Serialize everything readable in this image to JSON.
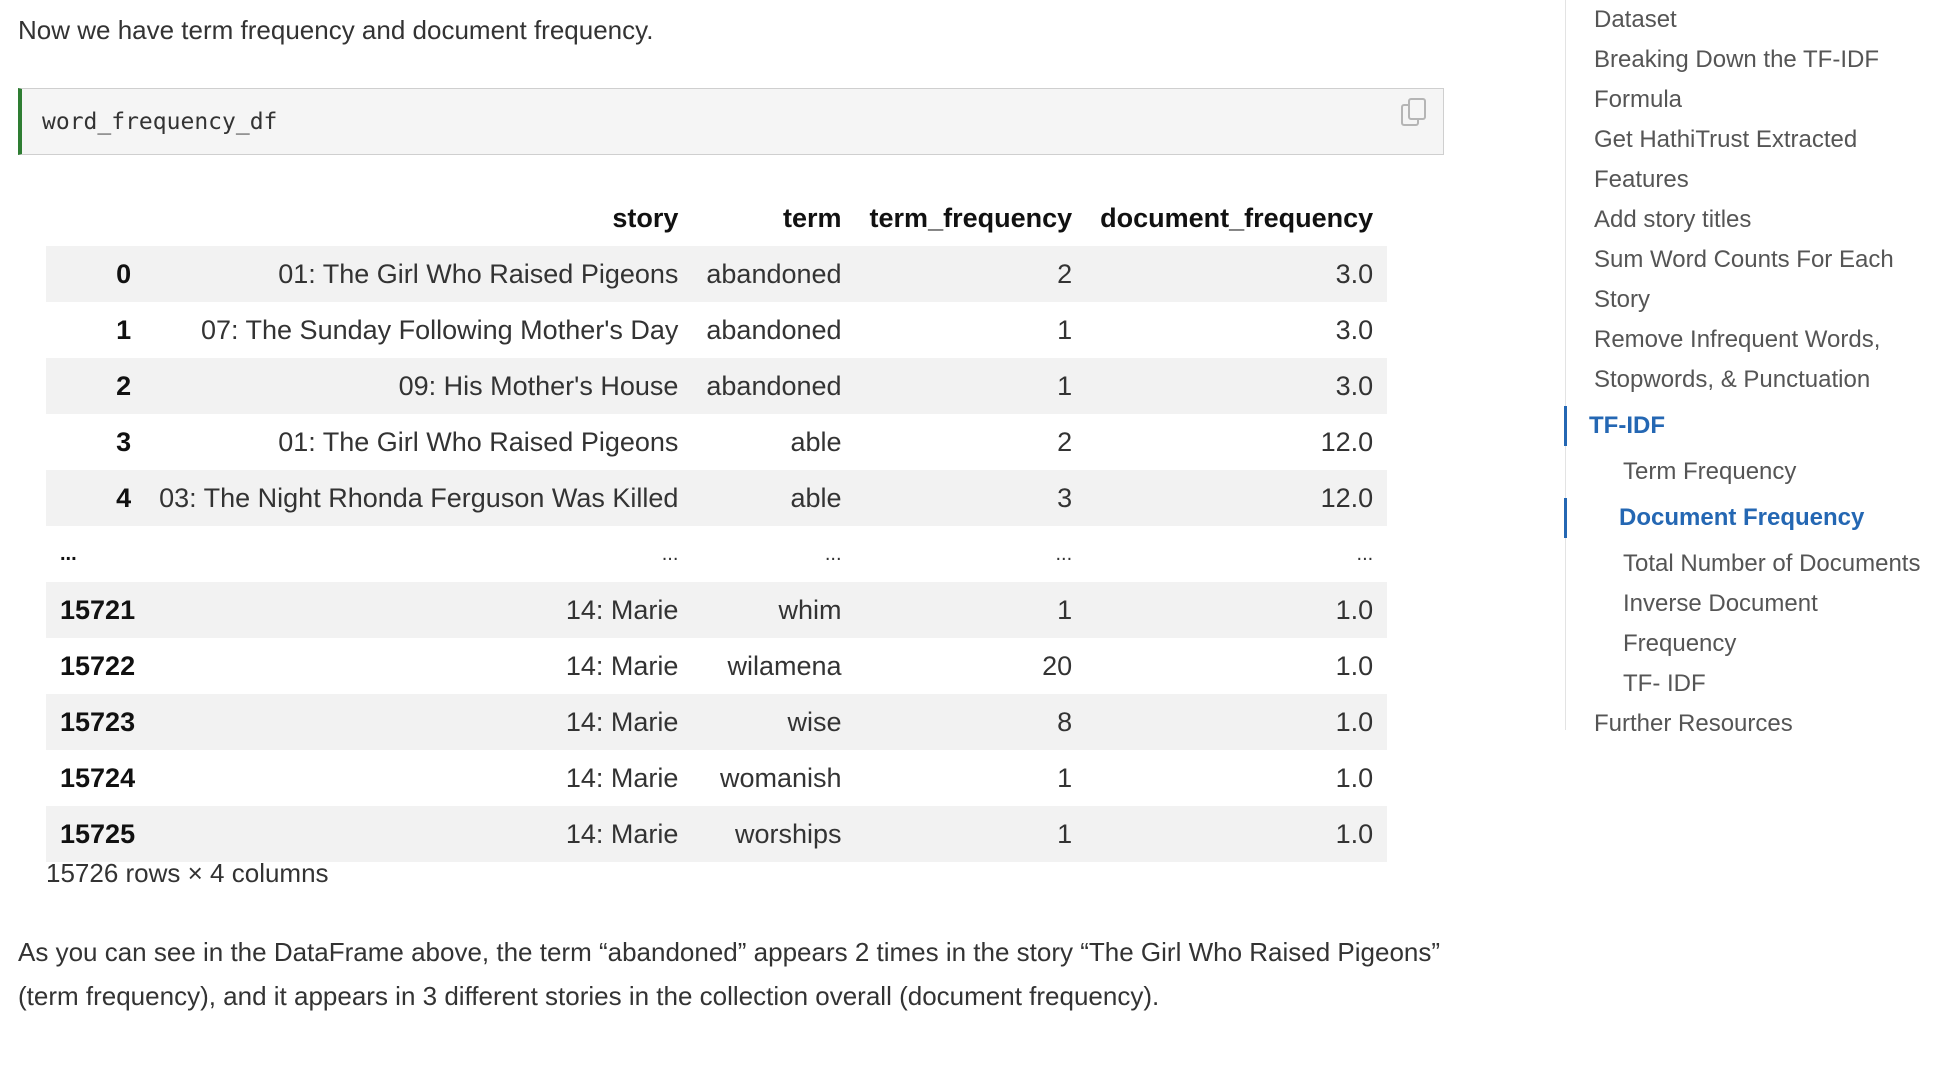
{
  "intro": "Now we have term frequency and document frequency.",
  "code_cell": {
    "code": "word_frequency_df"
  },
  "dataframe": {
    "columns": [
      "story",
      "term",
      "term_frequency",
      "document_frequency"
    ],
    "rows": [
      {
        "index": "0",
        "story": "01: The Girl Who Raised Pigeons",
        "term": "abandoned",
        "term_frequency": "2",
        "document_frequency": "3.0"
      },
      {
        "index": "1",
        "story": "07: The Sunday Following Mother's Day",
        "term": "abandoned",
        "term_frequency": "1",
        "document_frequency": "3.0"
      },
      {
        "index": "2",
        "story": "09: His Mother's House",
        "term": "abandoned",
        "term_frequency": "1",
        "document_frequency": "3.0"
      },
      {
        "index": "3",
        "story": "01: The Girl Who Raised Pigeons",
        "term": "able",
        "term_frequency": "2",
        "document_frequency": "12.0"
      },
      {
        "index": "4",
        "story": "03: The Night Rhonda Ferguson Was Killed",
        "term": "able",
        "term_frequency": "3",
        "document_frequency": "12.0"
      },
      {
        "index": "...",
        "story": "...",
        "term": "...",
        "term_frequency": "...",
        "document_frequency": "..."
      },
      {
        "index": "15721",
        "story": "14: Marie",
        "term": "whim",
        "term_frequency": "1",
        "document_frequency": "1.0"
      },
      {
        "index": "15722",
        "story": "14: Marie",
        "term": "wilamena",
        "term_frequency": "20",
        "document_frequency": "1.0"
      },
      {
        "index": "15723",
        "story": "14: Marie",
        "term": "wise",
        "term_frequency": "8",
        "document_frequency": "1.0"
      },
      {
        "index": "15724",
        "story": "14: Marie",
        "term": "womanish",
        "term_frequency": "1",
        "document_frequency": "1.0"
      },
      {
        "index": "15725",
        "story": "14: Marie",
        "term": "worships",
        "term_frequency": "1",
        "document_frequency": "1.0"
      }
    ],
    "shape": "15726 rows × 4 columns"
  },
  "paragraph": "As you can see in the DataFrame above, the term “abandoned” appears 2 times in the story “The Girl Who Raised Pigeons” (term frequency), and it appears in 3 different stories in the collection overall (document frequency).",
  "toc": {
    "items": [
      {
        "label": "Dataset",
        "level": 1,
        "active": false
      },
      {
        "label": "Breaking Down the TF-IDF Formula",
        "level": 1,
        "active": false
      },
      {
        "label": "Get HathiTrust Extracted Features",
        "level": 1,
        "active": false
      },
      {
        "label": "Add story titles",
        "level": 1,
        "active": false
      },
      {
        "label": "Sum Word Counts For Each Story",
        "level": 1,
        "active": false
      },
      {
        "label": "Remove Infrequent Words, Stopwords, & Punctuation",
        "level": 1,
        "active": false
      },
      {
        "label": "TF-IDF",
        "level": 1,
        "active": true
      },
      {
        "label": "Term Frequency",
        "level": 2,
        "active": false
      },
      {
        "label": "Document Frequency",
        "level": 2,
        "active": true
      },
      {
        "label": "Total Number of Documents",
        "level": 2,
        "active": false
      },
      {
        "label": "Inverse Document Frequency",
        "level": 2,
        "active": false
      },
      {
        "label": "TF- IDF",
        "level": 2,
        "active": false
      },
      {
        "label": "Further Resources",
        "level": 1,
        "active": false
      }
    ]
  },
  "colors": {
    "accent": "#2467b3",
    "code_border": "#2e7d32",
    "row_stripe": "#f2f2f2"
  }
}
